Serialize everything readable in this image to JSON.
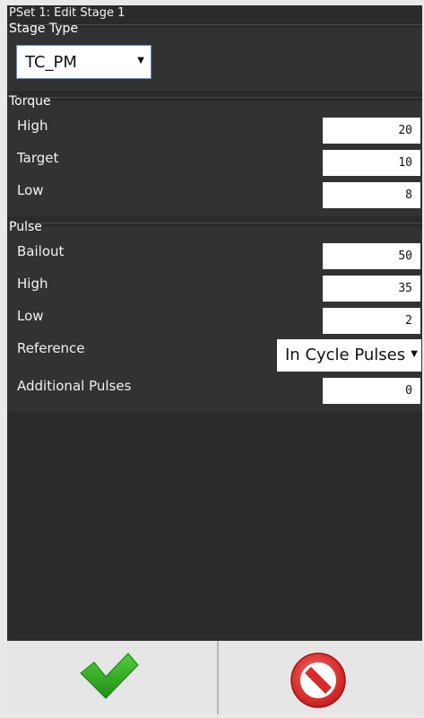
{
  "window": {
    "title": "PSet 1: Edit Stage 1"
  },
  "stage_type": {
    "label": "Stage Type",
    "select_value": "TC_PM"
  },
  "torque": {
    "label": "Torque",
    "fields": [
      {
        "label": "High",
        "value": "20"
      },
      {
        "label": "Target",
        "value": "10"
      },
      {
        "label": "Low",
        "value": "8"
      }
    ]
  },
  "pulse": {
    "label": "Pulse",
    "fields": [
      {
        "label": "Bailout",
        "value": "50"
      },
      {
        "label": "High",
        "value": "35"
      },
      {
        "label": "Low",
        "value": "2"
      }
    ],
    "reference": {
      "label": "Reference",
      "value": "In Cycle Pulses"
    },
    "additional": {
      "label": "Additional Pulses",
      "value": "0"
    }
  },
  "buttons": {
    "ok_icon": "checkmark-icon",
    "cancel_icon": "no-entry-icon"
  },
  "colors": {
    "panel_bg": "#2b2b2b",
    "ok_green": "#2eaa1f",
    "cancel_red": "#d82a2a"
  }
}
